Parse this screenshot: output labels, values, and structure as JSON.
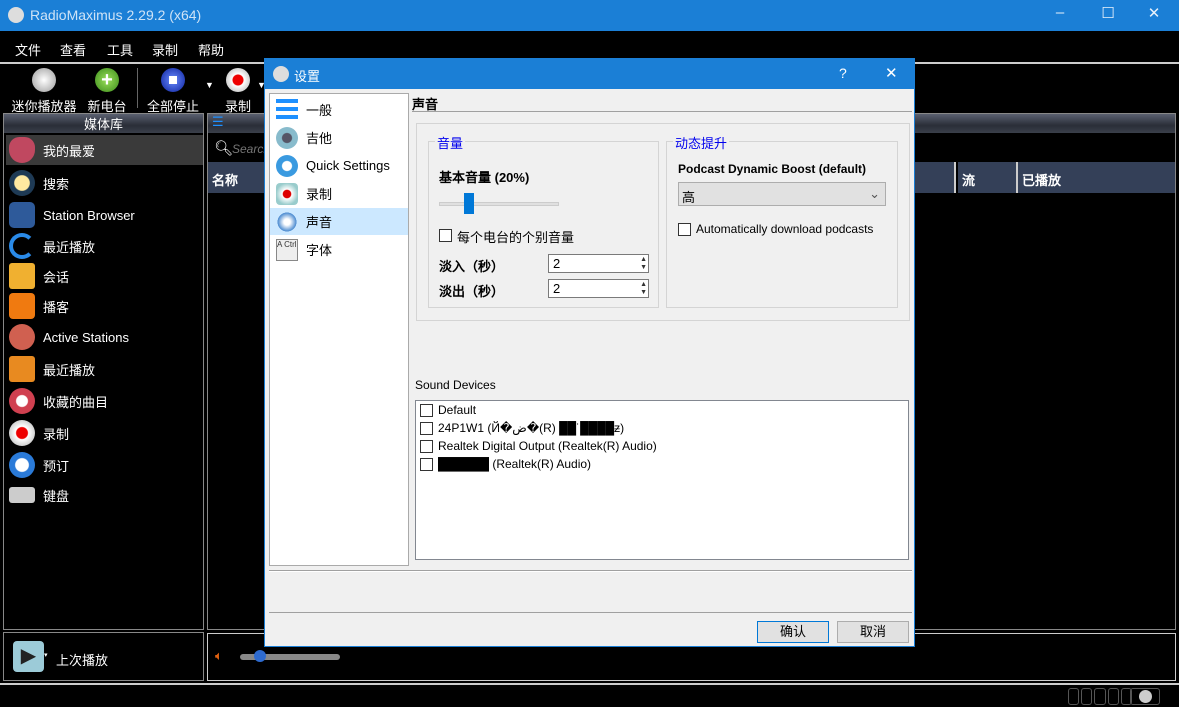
{
  "app": {
    "title": "RadioMaximus 2.29.2 (x64)",
    "controls": {
      "minimize": "–",
      "maximize": "☐",
      "close": "✕"
    }
  },
  "menu": [
    "文件",
    "查看",
    "工具",
    "录制",
    "帮助"
  ],
  "toolbar": [
    {
      "label": "迷你播放器",
      "icon": "mini-player-icon"
    },
    {
      "label": "新电台",
      "icon": "add-icon"
    },
    {
      "label": "全部停止",
      "icon": "stop-icon"
    },
    {
      "label": "录制",
      "icon": "record-icon"
    }
  ],
  "library": {
    "header": "媒体库",
    "items": [
      "我的最爱",
      "搜索",
      "Station Browser",
      "最近播放",
      "会话",
      "播客",
      "Active Stations",
      "最近播放",
      "收藏的曲目",
      "录制",
      "预订",
      "键盘"
    ]
  },
  "main": {
    "search_placeholder": "Search",
    "columns": [
      "名称",
      "流",
      "已播放"
    ]
  },
  "player": {
    "last_played": "上次播放",
    "volume_fraction": 0.2
  },
  "dialog": {
    "title": "设置",
    "help": "?",
    "close": "✕",
    "nav": [
      "一般",
      "吉他",
      "Quick Settings",
      "录制",
      "声音",
      "字体"
    ],
    "selected": "声音",
    "section_title": "声音",
    "volume_group": {
      "title": "音量",
      "base_volume_label": "基本音量 (20%)",
      "base_volume": 20,
      "per_station_label": "每个电台的个别音量",
      "fade_in_label": "淡入（秒）",
      "fade_in": "2",
      "fade_out_label": "淡出（秒）",
      "fade_out": "2"
    },
    "boost_group": {
      "title": "动态提升",
      "boost_label": "Podcast Dynamic Boost (default)",
      "boost_value": "高",
      "auto_download_label": "Automatically download podcasts"
    },
    "sound_devices_label": "Sound Devices",
    "sound_devices": [
      "Default",
      "24P1W1 (Й�ض�(R) ██˙████ƶ)",
      "Realtek Digital Output (Realtek(R) Audio)",
      "██████ (Realtek(R) Audio)"
    ],
    "ok": "确认",
    "cancel": "取消"
  },
  "colors": {
    "accent": "#1b7fd6",
    "selected_nav": "#cce8ff",
    "group_title": "#0000ee",
    "column_header": "#344058"
  }
}
